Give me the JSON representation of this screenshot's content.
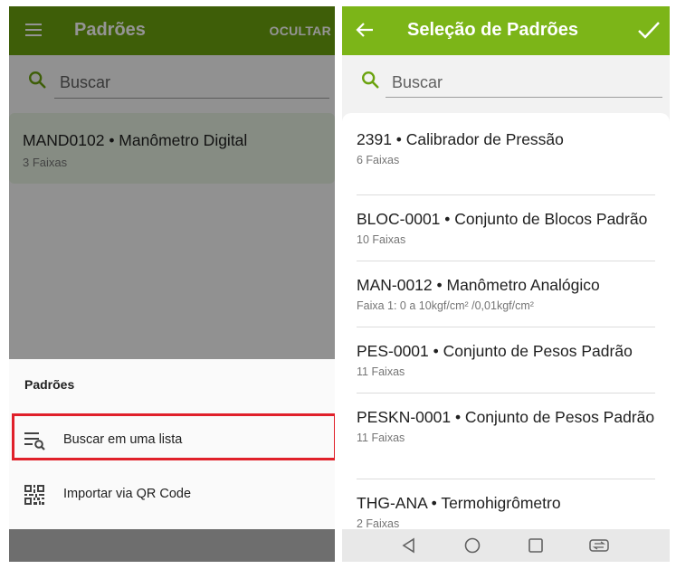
{
  "left_screen": {
    "appbar": {
      "title": "Padrões",
      "action_label": "OCULTAR"
    },
    "search": {
      "placeholder": "Buscar"
    },
    "card": {
      "title": "MAND0102 • Manômetro Digital",
      "subtitle": "3 Faixas"
    },
    "bottom_sheet": {
      "title": "Padrões",
      "options": [
        {
          "label": "Buscar em uma lista",
          "icon": "list-search-icon",
          "highlighted": true
        },
        {
          "label": "Importar via QR Code",
          "icon": "qr-code-icon",
          "highlighted": false
        }
      ]
    },
    "highlight_color": "#e0202a"
  },
  "right_screen": {
    "appbar": {
      "title": "Seleção de Padrões"
    },
    "search": {
      "placeholder": "Buscar"
    },
    "items": [
      {
        "title": "2391 • Calibrador de Pressão",
        "subtitle": "6 Faixas"
      },
      {
        "title": "BLOC-0001 • Conjunto de Blocos Padrão",
        "subtitle": "10 Faixas"
      },
      {
        "title": "MAN-0012 • Manômetro Analógico",
        "subtitle": "Faixa 1: 0 a 10kgf/cm² /0,01kgf/cm²"
      },
      {
        "title": "PES-0001 • Conjunto de Pesos Padrão",
        "subtitle": "11 Faixas"
      },
      {
        "title": "PESKN-0001 • Conjunto de Pesos Padrão",
        "subtitle": "11 Faixas"
      },
      {
        "title": "THG-ANA • Termohigrômetro",
        "subtitle": "2 Faixas"
      }
    ]
  },
  "colors": {
    "appbar_green": "#7cb518",
    "search_icon_green": "#6ba30e"
  }
}
